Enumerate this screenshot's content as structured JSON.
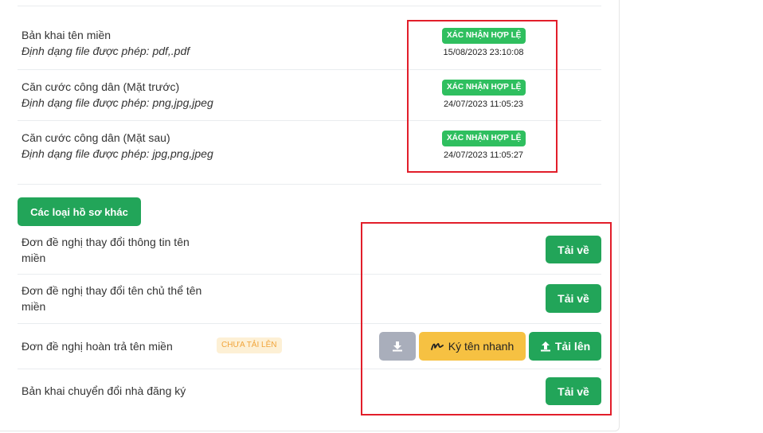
{
  "documents": [
    {
      "name": "Bản khai tên miền",
      "format": "Định dạng file được phép: pdf,.pdf",
      "status": "XÁC NHẬN HỢP LỆ",
      "time": "15/08/2023 23:10:08"
    },
    {
      "name": "Căn cước công dân (Mặt trước)",
      "format": "Định dạng file được phép: png,jpg,jpeg",
      "status": "XÁC NHẬN HỢP LỆ",
      "time": "24/07/2023 11:05:23"
    },
    {
      "name": "Căn cước công dân (Mặt sau)",
      "format": "Định dạng file được phép: jpg,png,jpeg",
      "status": "XÁC NHẬN HỢP LỆ",
      "time": "24/07/2023 11:05:27"
    }
  ],
  "other_section": {
    "button_label": "Các loại hồ sơ khác"
  },
  "forms": [
    {
      "name": "Đơn đề nghị thay đổi thông tin tên miền",
      "download_label": "Tải về"
    },
    {
      "name": "Đơn đề nghị thay đổi tên chủ thể tên miền",
      "download_label": "Tải về"
    },
    {
      "name": "Đơn đề nghị hoàn trả tên miền",
      "status": "CHƯA TẢI LÊN",
      "sign_label": "Ký tên nhanh",
      "upload_label": "Tải lên"
    },
    {
      "name": "Bản khai chuyển đổi nhà đăng ký",
      "download_label": "Tải về"
    }
  ],
  "colors": {
    "success": "#22a559",
    "badge_green": "#2fbf5f",
    "warning": "#f6c142",
    "pending_bg": "#fdf0d5",
    "pending_text": "#f1a43a",
    "highlight": "#e21e2a"
  },
  "icons": {
    "download": "download-icon",
    "signature": "signature-icon",
    "upload": "upload-icon"
  }
}
